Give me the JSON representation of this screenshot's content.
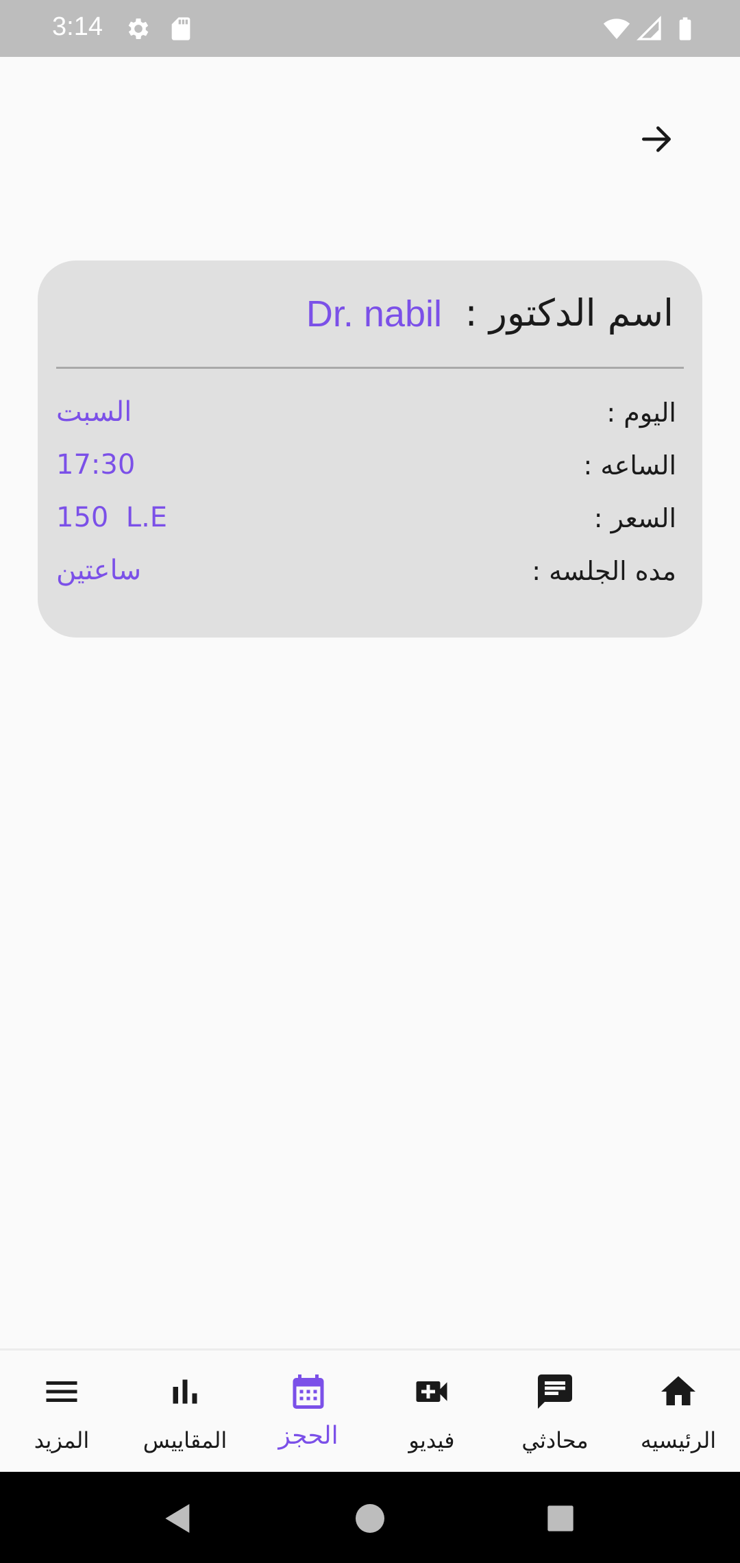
{
  "status_bar": {
    "time": "3:14",
    "icons": [
      "gear-icon",
      "sd-card-icon",
      "wifi-icon",
      "signal-icon",
      "battery-icon"
    ]
  },
  "header": {
    "back_icon": "arrow-right-icon"
  },
  "booking": {
    "doctor_label": "اسم الدكتور :",
    "doctor_name": "Dr. nabil",
    "rows": [
      {
        "label": "اليوم :",
        "value": "السبت"
      },
      {
        "label": "الساعه :",
        "value": "17:30"
      },
      {
        "label": "السعر :",
        "value": "150  L.E"
      },
      {
        "label": "مده الجلسه :",
        "value": "ساعتين"
      }
    ]
  },
  "bottom_nav": {
    "items": [
      {
        "label": "المزيد",
        "icon": "menu-icon"
      },
      {
        "label": "المقاييس",
        "icon": "bar-chart-icon"
      },
      {
        "label": "الحجز",
        "icon": "calendar-icon",
        "active": true
      },
      {
        "label": "فيديو",
        "icon": "video-add-icon"
      },
      {
        "label": "محادثي",
        "icon": "chat-icon"
      },
      {
        "label": "الرئيسيه",
        "icon": "home-icon"
      }
    ]
  },
  "colors": {
    "accent": "#7b50e8",
    "card_bg": "#e0e0e0",
    "status_bar": "#bdbdbd",
    "background": "#fafafa"
  }
}
